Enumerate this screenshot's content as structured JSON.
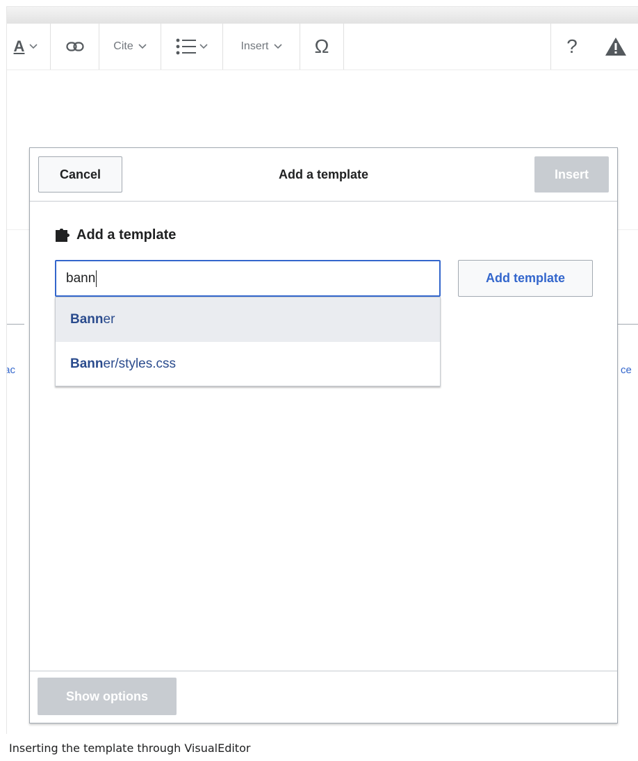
{
  "toolbar": {
    "text_style_glyph": "A",
    "cite_label": "Cite",
    "insert_label": "Insert",
    "special_char": "Ω",
    "help_glyph": "?",
    "icons": [
      "text-style-icon",
      "chevron-down-icon",
      "link-icon",
      "list-icon",
      "special-character-icon",
      "help-icon",
      "warning-icon"
    ]
  },
  "background": {
    "left_fragment": "/ac",
    "right_fragment": "ce"
  },
  "dialog": {
    "title": "Add a template",
    "cancel_label": "Cancel",
    "insert_label": "Insert",
    "section_label": "Add a template",
    "search": {
      "value": "bann"
    },
    "add_template_label": "Add template",
    "suggestions": [
      {
        "match": "Bann",
        "rest": "er"
      },
      {
        "match": "Bann",
        "rest": "er/styles.css"
      }
    ],
    "show_options_label": "Show options"
  },
  "caption": "Inserting the template through VisualEditor",
  "colors": {
    "accent": "#3366cc",
    "disabled_button": "#c8ccd1",
    "suggestion_text": "#2a4b8d",
    "highlight_row": "#eaecf0"
  }
}
